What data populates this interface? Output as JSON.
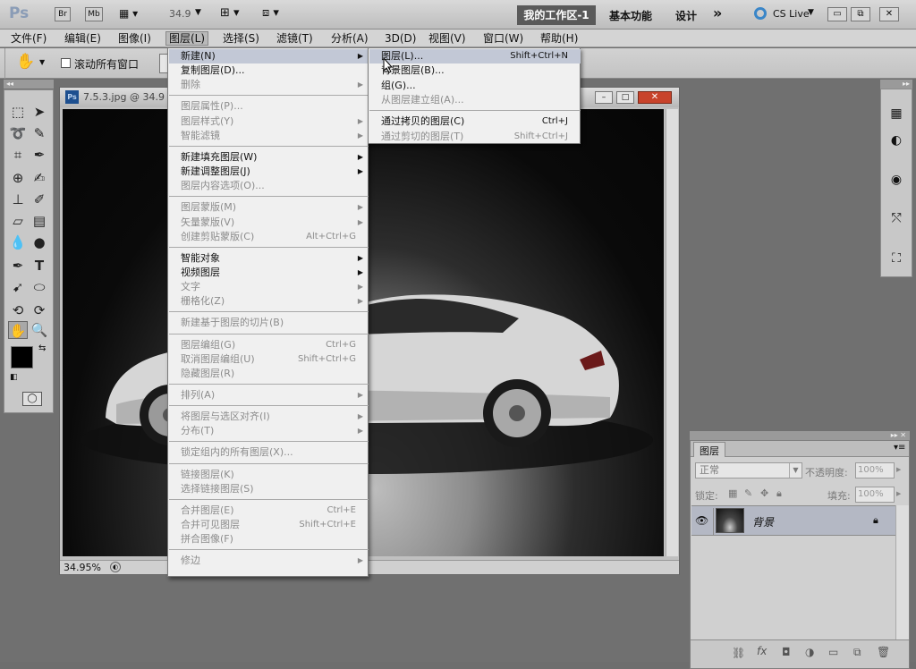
{
  "appbar": {
    "logo": "Ps",
    "br": "Br",
    "mb": "Mb",
    "zoom": "34.9",
    "workspace_active": "我的工作区-1",
    "essentials": "基本功能",
    "design": "设计",
    "more": "»",
    "cslive": "CS Live"
  },
  "menubar": [
    "文件(F)",
    "编辑(E)",
    "图像(I)",
    "图层(L)",
    "选择(S)",
    "滤镜(T)",
    "分析(A)",
    "3D(D)",
    "视图(V)",
    "窗口(W)",
    "帮助(H)"
  ],
  "options": {
    "scroll_all": "滚动所有窗口"
  },
  "document": {
    "title": "7.5.3.jpg @ 34.9",
    "zoom": "34.95%"
  },
  "layer_menu": [
    {
      "label": "新建(N)",
      "sub": true,
      "hl": true
    },
    {
      "label": "复制图层(D)..."
    },
    {
      "label": "删除",
      "sub": true,
      "dis": true
    },
    {
      "sep": true
    },
    {
      "label": "图层属性(P)...",
      "dis": true
    },
    {
      "label": "图层样式(Y)",
      "sub": true,
      "dis": true
    },
    {
      "label": "智能滤镜",
      "sub": true,
      "dis": true
    },
    {
      "sep": true
    },
    {
      "label": "新建填充图层(W)",
      "sub": true
    },
    {
      "label": "新建调整图层(J)",
      "sub": true
    },
    {
      "label": "图层内容选项(O)...",
      "dis": true
    },
    {
      "sep": true
    },
    {
      "label": "图层蒙版(M)",
      "sub": true,
      "dis": true
    },
    {
      "label": "矢量蒙版(V)",
      "sub": true,
      "dis": true
    },
    {
      "label": "创建剪贴蒙版(C)",
      "sc": "Alt+Ctrl+G",
      "dis": true
    },
    {
      "sep": true
    },
    {
      "label": "智能对象",
      "sub": true
    },
    {
      "label": "视频图层",
      "sub": true
    },
    {
      "label": "文字",
      "sub": true,
      "dis": true
    },
    {
      "label": "栅格化(Z)",
      "sub": true,
      "dis": true
    },
    {
      "sep": true
    },
    {
      "label": "新建基于图层的切片(B)",
      "dis": true
    },
    {
      "sep": true
    },
    {
      "label": "图层编组(G)",
      "sc": "Ctrl+G",
      "dis": true
    },
    {
      "label": "取消图层编组(U)",
      "sc": "Shift+Ctrl+G",
      "dis": true
    },
    {
      "label": "隐藏图层(R)",
      "dis": true
    },
    {
      "sep": true
    },
    {
      "label": "排列(A)",
      "sub": true,
      "dis": true
    },
    {
      "sep": true
    },
    {
      "label": "将图层与选区对齐(I)",
      "sub": true,
      "dis": true
    },
    {
      "label": "分布(T)",
      "sub": true,
      "dis": true
    },
    {
      "sep": true
    },
    {
      "label": "锁定组内的所有图层(X)...",
      "dis": true
    },
    {
      "sep": true
    },
    {
      "label": "链接图层(K)",
      "dis": true
    },
    {
      "label": "选择链接图层(S)",
      "dis": true
    },
    {
      "sep": true
    },
    {
      "label": "合并图层(E)",
      "sc": "Ctrl+E",
      "dis": true
    },
    {
      "label": "合并可见图层",
      "sc": "Shift+Ctrl+E",
      "dis": true
    },
    {
      "label": "拼合图像(F)",
      "dis": true
    },
    {
      "sep": true
    },
    {
      "label": "修边",
      "sub": true,
      "dis": true
    }
  ],
  "new_submenu": [
    {
      "label": "图层(L)...",
      "sc": "Shift+Ctrl+N",
      "hl": true
    },
    {
      "label": "背景图层(B)..."
    },
    {
      "label": "组(G)..."
    },
    {
      "label": "从图层建立组(A)...",
      "dis": true
    },
    {
      "sep": true
    },
    {
      "label": "通过拷贝的图层(C)",
      "sc": "Ctrl+J"
    },
    {
      "label": "通过剪切的图层(T)",
      "sc": "Shift+Ctrl+J",
      "dis": true
    }
  ],
  "layers_panel": {
    "tab": "图层",
    "blend": "正常",
    "opacity_label": "不透明度:",
    "opacity": "100%",
    "lock_label": "锁定:",
    "fill_label": "填充:",
    "fill": "100%",
    "layer_name": "背景"
  }
}
